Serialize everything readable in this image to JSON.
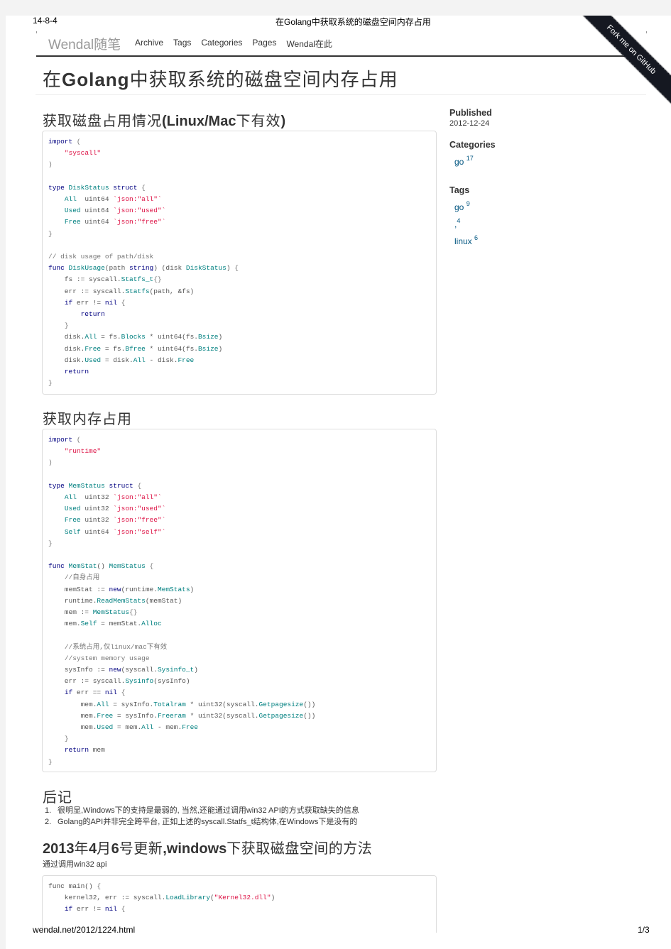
{
  "print_header": {
    "date": "14-8-4",
    "title": "在Golang中获取系统的磁盘空间内存占用"
  },
  "print_footer": {
    "url": "wendal.net/2012/1224.html",
    "page": "1/3"
  },
  "navbar": {
    "brand": "Wendal随笔",
    "links": [
      "Archive",
      "Tags",
      "Categories",
      "Pages",
      "Wendal在此"
    ]
  },
  "ribbon": {
    "label": "Fork me on GitHub"
  },
  "article": {
    "title_prefix": "在",
    "title_bold": "Golang",
    "title_suffix": "中获取系统的磁盘空间内存占用",
    "section1": {
      "prefix": "获取磁盘占用情况",
      "bold": "(Linux/Mac",
      "suffix": "下有效",
      "end": ")"
    },
    "section2": {
      "title": "获取内存占用"
    },
    "section3": {
      "title": "后记"
    },
    "notes": [
      {
        "num": "1.",
        "text": "很明显,Windows下的支持是最弱的, 当然,还能通过调用win32 API的方式获取缺失的信息"
      },
      {
        "num": "2.",
        "text": "Golang的API并非完全跨平台, 正如上述的syscall.Statfs_t结构体,在Windows下是没有的"
      }
    ],
    "section4": {
      "b1": "2013",
      "t1": "年",
      "b2": "4",
      "t2": "月",
      "b3": "6",
      "t3": "号更新",
      "b4": ",windows",
      "t4": "下获取磁盘空间的方法"
    },
    "section4_text": "通过调用win32 api",
    "code1": [
      [
        [
          "kw",
          "import"
        ],
        [
          "cm",
          " ("
        ]
      ],
      [
        [
          "",
          "    "
        ],
        [
          "st",
          "\"syscall\""
        ]
      ],
      [
        [
          "cm",
          ")"
        ]
      ],
      [
        [
          "",
          ""
        ]
      ],
      [
        [
          "kw",
          "type "
        ],
        [
          "ty",
          "DiskStatus"
        ],
        [
          "kw",
          " struct"
        ],
        [
          "cm",
          " {"
        ]
      ],
      [
        [
          "",
          "    "
        ],
        [
          "ty",
          "All"
        ],
        [
          "",
          "  uint64 "
        ],
        [
          "st",
          "`json:\"all\"`"
        ]
      ],
      [
        [
          "",
          "    "
        ],
        [
          "ty",
          "Used"
        ],
        [
          "",
          " uint64 "
        ],
        [
          "st",
          "`json:\"used\"`"
        ]
      ],
      [
        [
          "",
          "    "
        ],
        [
          "ty",
          "Free"
        ],
        [
          "",
          " uint64 "
        ],
        [
          "st",
          "`json:\"free\"`"
        ]
      ],
      [
        [
          "cm",
          "}"
        ]
      ],
      [
        [
          "",
          ""
        ]
      ],
      [
        [
          "cm",
          "// disk usage of path/disk"
        ]
      ],
      [
        [
          "kw",
          "func "
        ],
        [
          "ty",
          "DiskUsage"
        ],
        [
          "",
          "(path "
        ],
        [
          "kw",
          "string"
        ],
        [
          "",
          ") (disk "
        ],
        [
          "ty",
          "DiskStatus"
        ],
        [
          "",
          ") "
        ],
        [
          "cm",
          "{"
        ]
      ],
      [
        [
          "",
          "    fs := syscall."
        ],
        [
          "ty",
          "Statfs_t"
        ],
        [
          "cm",
          "{}"
        ]
      ],
      [
        [
          "",
          "    err := syscall."
        ],
        [
          "ty",
          "Statfs"
        ],
        [
          "",
          "(path, &fs)"
        ]
      ],
      [
        [
          "",
          "    "
        ],
        [
          "kw",
          "if"
        ],
        [
          "",
          " err != "
        ],
        [
          "kw",
          "nil"
        ],
        [
          "cm",
          " {"
        ]
      ],
      [
        [
          "",
          "        "
        ],
        [
          "kw",
          "return"
        ]
      ],
      [
        [
          "",
          "    "
        ],
        [
          "cm",
          "}"
        ]
      ],
      [
        [
          "",
          "    disk."
        ],
        [
          "ty",
          "All"
        ],
        [
          "",
          " = fs."
        ],
        [
          "ty",
          "Blocks"
        ],
        [
          "",
          " * uint64(fs."
        ],
        [
          "ty",
          "Bsize"
        ],
        [
          "",
          ")"
        ]
      ],
      [
        [
          "",
          "    disk."
        ],
        [
          "ty",
          "Free"
        ],
        [
          "",
          " = fs."
        ],
        [
          "ty",
          "Bfree"
        ],
        [
          "",
          " * uint64(fs."
        ],
        [
          "ty",
          "Bsize"
        ],
        [
          "",
          ")"
        ]
      ],
      [
        [
          "",
          "    disk."
        ],
        [
          "ty",
          "Used"
        ],
        [
          "",
          " = disk."
        ],
        [
          "ty",
          "All"
        ],
        [
          "",
          " - disk."
        ],
        [
          "ty",
          "Free"
        ]
      ],
      [
        [
          "",
          "    "
        ],
        [
          "kw",
          "return"
        ]
      ],
      [
        [
          "cm",
          "}"
        ]
      ]
    ],
    "code2": [
      [
        [
          "kw",
          "import"
        ],
        [
          "cm",
          " ("
        ]
      ],
      [
        [
          "",
          "    "
        ],
        [
          "st",
          "\"runtime\""
        ]
      ],
      [
        [
          "cm",
          ")"
        ]
      ],
      [
        [
          "",
          ""
        ]
      ],
      [
        [
          "kw",
          "type "
        ],
        [
          "ty",
          "MemStatus"
        ],
        [
          "kw",
          " struct"
        ],
        [
          "cm",
          " {"
        ]
      ],
      [
        [
          "",
          "    "
        ],
        [
          "ty",
          "All"
        ],
        [
          "",
          "  uint32 "
        ],
        [
          "st",
          "`json:\"all\"`"
        ]
      ],
      [
        [
          "",
          "    "
        ],
        [
          "ty",
          "Used"
        ],
        [
          "",
          " uint32 "
        ],
        [
          "st",
          "`json:\"used\"`"
        ]
      ],
      [
        [
          "",
          "    "
        ],
        [
          "ty",
          "Free"
        ],
        [
          "",
          " uint32 "
        ],
        [
          "st",
          "`json:\"free\"`"
        ]
      ],
      [
        [
          "",
          "    "
        ],
        [
          "ty",
          "Self"
        ],
        [
          "",
          " uint64 "
        ],
        [
          "st",
          "`json:\"self\"`"
        ]
      ],
      [
        [
          "cm",
          "}"
        ]
      ],
      [
        [
          "",
          ""
        ]
      ],
      [
        [
          "kw",
          "func "
        ],
        [
          "ty",
          "MemStat"
        ],
        [
          "",
          "() "
        ],
        [
          "ty",
          "MemStatus"
        ],
        [
          "cm",
          " {"
        ]
      ],
      [
        [
          "",
          "    "
        ],
        [
          "cm",
          "//自身占用"
        ]
      ],
      [
        [
          "",
          "    memStat := "
        ],
        [
          "kw",
          "new"
        ],
        [
          "",
          "(runtime."
        ],
        [
          "ty",
          "MemStats"
        ],
        [
          "",
          ")"
        ]
      ],
      [
        [
          "",
          "    runtime."
        ],
        [
          "ty",
          "ReadMemStats"
        ],
        [
          "",
          "(memStat)"
        ]
      ],
      [
        [
          "",
          "    mem := "
        ],
        [
          "ty",
          "MemStatus"
        ],
        [
          "cm",
          "{}"
        ]
      ],
      [
        [
          "",
          "    mem."
        ],
        [
          "ty",
          "Self"
        ],
        [
          "",
          " = memStat."
        ],
        [
          "ty",
          "Alloc"
        ]
      ],
      [
        [
          "",
          ""
        ]
      ],
      [
        [
          "",
          "    "
        ],
        [
          "cm",
          "//系统占用,仅linux/mac下有效"
        ]
      ],
      [
        [
          "",
          "    "
        ],
        [
          "cm",
          "//system memory usage"
        ]
      ],
      [
        [
          "",
          "    sysInfo := "
        ],
        [
          "kw",
          "new"
        ],
        [
          "",
          "(syscall."
        ],
        [
          "ty",
          "Sysinfo_t"
        ],
        [
          "",
          ")"
        ]
      ],
      [
        [
          "",
          "    err := syscall."
        ],
        [
          "ty",
          "Sysinfo"
        ],
        [
          "",
          "(sysInfo)"
        ]
      ],
      [
        [
          "",
          "    "
        ],
        [
          "kw",
          "if"
        ],
        [
          "",
          " err == "
        ],
        [
          "kw",
          "nil"
        ],
        [
          "cm",
          " {"
        ]
      ],
      [
        [
          "",
          "        mem."
        ],
        [
          "ty",
          "All"
        ],
        [
          "",
          " = sysInfo."
        ],
        [
          "ty",
          "Totalram"
        ],
        [
          "",
          " * uint32(syscall."
        ],
        [
          "ty",
          "Getpagesize"
        ],
        [
          "",
          "())"
        ]
      ],
      [
        [
          "",
          "        mem."
        ],
        [
          "ty",
          "Free"
        ],
        [
          "",
          " = sysInfo."
        ],
        [
          "ty",
          "Freeram"
        ],
        [
          "",
          " * uint32(syscall."
        ],
        [
          "ty",
          "Getpagesize"
        ],
        [
          "",
          "())"
        ]
      ],
      [
        [
          "",
          "        mem."
        ],
        [
          "ty",
          "Used"
        ],
        [
          "",
          " = mem."
        ],
        [
          "ty",
          "All"
        ],
        [
          "",
          " - mem."
        ],
        [
          "ty",
          "Free"
        ]
      ],
      [
        [
          "",
          "    "
        ],
        [
          "cm",
          "}"
        ]
      ],
      [
        [
          "",
          "    "
        ],
        [
          "kw",
          "return"
        ],
        [
          "",
          " mem"
        ]
      ],
      [
        [
          "cm",
          "}"
        ]
      ]
    ],
    "code3": [
      [
        [
          "",
          "func main() "
        ],
        [
          "cm",
          "{"
        ]
      ],
      [
        [
          "",
          "    kernel32, err := syscall."
        ],
        [
          "ty",
          "LoadLibrary"
        ],
        [
          "",
          "("
        ],
        [
          "st",
          "\"Kernel32.dll\""
        ],
        [
          "",
          ")"
        ]
      ],
      [
        [
          "",
          "    "
        ],
        [
          "kw",
          "if"
        ],
        [
          "",
          " err != "
        ],
        [
          "kw",
          "nil"
        ],
        [
          "cm",
          " {"
        ]
      ]
    ]
  },
  "sidebar": {
    "published_label": "Published",
    "published_date": "2012-12-24",
    "categories_label": "Categories",
    "categories": [
      {
        "name": "go",
        "count": "17"
      }
    ],
    "tags_label": "Tags",
    "tags": [
      {
        "name": "go",
        "count": "9"
      },
      {
        "name": ",",
        "count": "4"
      },
      {
        "name": "linux",
        "count": "6"
      }
    ]
  }
}
